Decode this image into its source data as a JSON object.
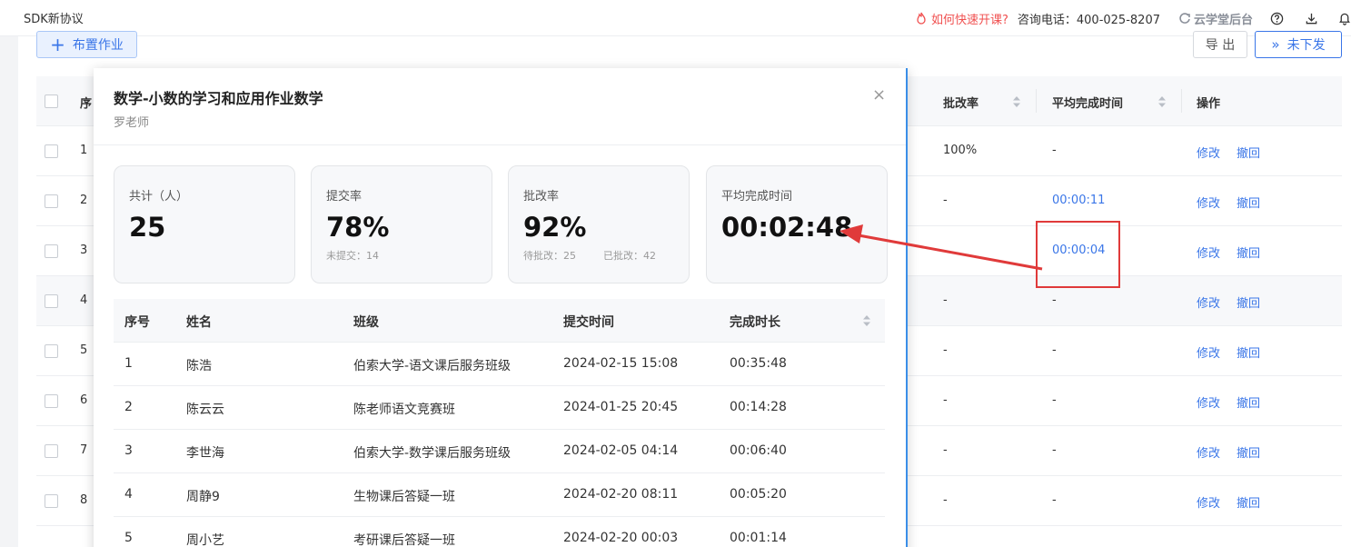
{
  "topbar": {
    "title": "SDK新协议",
    "help_link": "如何快速开课?",
    "phone": "咨询电话：400-025-8207",
    "admin": "云学堂后台",
    "icons": [
      "question-circle-icon",
      "download-icon",
      "bell-icon"
    ]
  },
  "toolbar": {
    "assign_label": "布置作业",
    "export_label": "导 出",
    "unsent_label": "未下发"
  },
  "bg_table": {
    "headers": {
      "seq": "序",
      "rate": "批改率",
      "avg": "平均完成时间",
      "op": "操作"
    },
    "rows": [
      {
        "seq": "1",
        "rate": "100%",
        "avg": "-",
        "edit": "修改",
        "revoke": "撤回"
      },
      {
        "seq": "2",
        "rate": "-",
        "avg": "00:00:11",
        "edit": "修改",
        "revoke": "撤回"
      },
      {
        "seq": "3",
        "rate": "",
        "avg": "00:00:04",
        "edit": "修改",
        "revoke": "撤回"
      },
      {
        "seq": "4",
        "rate": "-",
        "avg": "-",
        "edit": "修改",
        "revoke": "撤回"
      },
      {
        "seq": "5",
        "rate": "-",
        "avg": "-",
        "edit": "修改",
        "revoke": "撤回"
      },
      {
        "seq": "6",
        "rate": "-",
        "avg": "-",
        "edit": "修改",
        "revoke": "撤回"
      },
      {
        "seq": "7",
        "rate": "-",
        "avg": "-",
        "edit": "修改",
        "revoke": "撤回"
      },
      {
        "seq": "8",
        "rate": "-",
        "avg": "-",
        "edit": "修改",
        "revoke": "撤回"
      }
    ]
  },
  "modal": {
    "title": "数学-小数的学习和应用作业数学",
    "teacher": "罗老师",
    "close": "×",
    "stats": [
      {
        "label": "共计（人）",
        "value": "25"
      },
      {
        "label": "提交率",
        "value": "78%",
        "note": "未提交：14"
      },
      {
        "label": "批改率",
        "value": "92%",
        "note1": "待批改：25",
        "note2": "已批改：42"
      },
      {
        "label": "平均完成时间",
        "value": "00:02:48"
      }
    ],
    "table": {
      "headers": [
        "序号",
        "姓名",
        "班级",
        "提交时间",
        "完成时长"
      ],
      "rows": [
        [
          "1",
          "陈浩",
          "伯索大学-语文课后服务班级",
          "2024-02-15 15:08",
          "00:35:48"
        ],
        [
          "2",
          "陈云云",
          "陈老师语文竞赛班",
          "2024-01-25 20:45",
          "00:14:28"
        ],
        [
          "3",
          "李世海",
          "伯索大学-数学课后服务班级",
          "2024-02-05 04:14",
          "00:06:40"
        ],
        [
          "4",
          "周静9",
          "生物课后答疑一班",
          "2024-02-20 08:11",
          "00:05:20"
        ],
        [
          "5",
          "周小艺",
          "考研课后答疑一班",
          "2024-02-20 00:03",
          "00:01:14"
        ]
      ]
    }
  },
  "colors": {
    "primary": "#3a76e8",
    "danger": "#e03a3a",
    "muted": "#8a8f99"
  }
}
